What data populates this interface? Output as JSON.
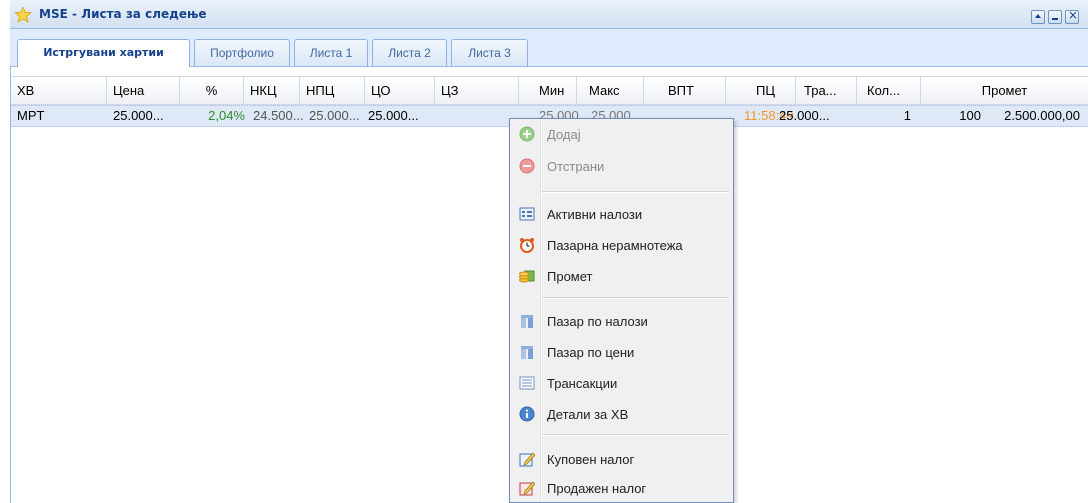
{
  "window": {
    "title": "MSE - Листа за следење"
  },
  "tabs": [
    "Истргувани хартии",
    "Портфолио",
    "Листа 1",
    "Листа 2",
    "Листа 3"
  ],
  "columns": [
    "ХВ",
    "Цена",
    "%",
    "НКЦ",
    "НПЦ",
    "ЦО",
    "ЦЗ",
    "Мин",
    "Макс",
    "ВПТ",
    "ПЦ",
    "Тра...",
    "Кол...",
    "Промет"
  ],
  "row": {
    "hv": "MPT",
    "cena": "25.000...",
    "pct": "2,04%",
    "nkc": "24.500...",
    "npc": "25.000...",
    "co": "25.000...",
    "cz": "",
    "min": "25.000...",
    "maks": "25.000...",
    "vpt": "11:58:49",
    "pc": "25.000...",
    "tra": "1",
    "kol": "100",
    "promet": "2.500.000,00"
  },
  "colors": {
    "positive": "#2e8b2e",
    "time": "#f2962b",
    "selected_row": "#dfe8f6"
  },
  "menu": {
    "add": "Додај",
    "remove": "Отстрани",
    "active_orders": "Активни налози",
    "market_imbalance": "Пазарна нерамнотежа",
    "turnover": "Промет",
    "market_by_orders": "Пазар по налози",
    "market_by_prices": "Пазар по цени",
    "transactions": "Трансакции",
    "details": "Детали за ХВ",
    "buy_order": "Куповен налог",
    "sell_order": "Продажен налог"
  },
  "icons": {
    "add": "plus-circle-icon",
    "remove": "minus-circle-icon",
    "active_orders": "order-list-icon",
    "market_imbalance": "alarm-clock-icon",
    "turnover": "coins-icon",
    "market_by_orders": "column-icon",
    "market_by_prices": "column-icon",
    "transactions": "list-icon",
    "details": "info-icon",
    "buy_order": "pencil-blue-icon",
    "sell_order": "pencil-red-icon"
  }
}
